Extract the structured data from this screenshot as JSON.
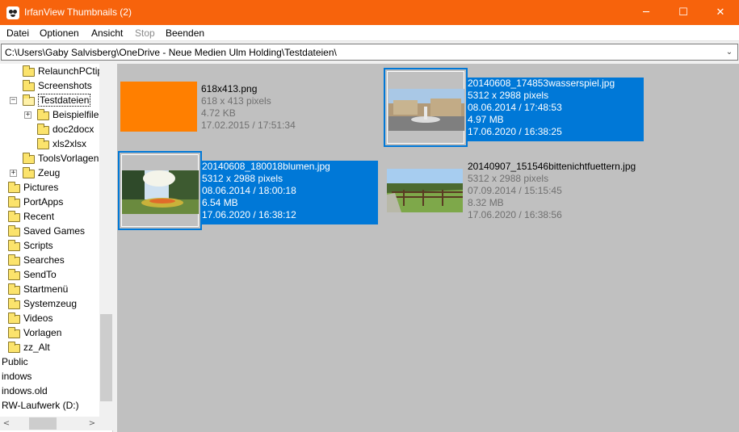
{
  "window": {
    "title": "IrfanView Thumbnails (2)",
    "minimize_glyph": "─",
    "maximize_glyph": "☐",
    "close_glyph": "✕"
  },
  "menu": {
    "items": [
      {
        "label": "Datei",
        "enabled": true
      },
      {
        "label": "Optionen",
        "enabled": true
      },
      {
        "label": "Ansicht",
        "enabled": true
      },
      {
        "label": "Stop",
        "enabled": false
      },
      {
        "label": "Beenden",
        "enabled": true
      }
    ]
  },
  "pathbar": {
    "path": "C:\\Users\\Gaby Salvisberg\\OneDrive - Neue Medien Ulm Holding\\Testdateien\\",
    "dropdown_glyph": "⌄"
  },
  "tree": {
    "items": [
      {
        "label": "RelaunchPCtip",
        "expander": "",
        "open": false
      },
      {
        "label": "Screenshots",
        "expander": "",
        "open": false
      },
      {
        "label": "Testdateien",
        "expander": "−",
        "open": true,
        "selected": true
      },
      {
        "label": "Beispielfile",
        "expander": "+",
        "open": false
      },
      {
        "label": "doc2docx",
        "expander": "",
        "open": false
      },
      {
        "label": "xls2xlsx",
        "expander": "",
        "open": false
      },
      {
        "label": "ToolsVorlagen",
        "expander": "",
        "open": false
      },
      {
        "label": "Zeug",
        "expander": "+",
        "open": false
      },
      {
        "label": "Pictures",
        "expander": "",
        "open": false
      },
      {
        "label": "PortApps",
        "expander": "",
        "open": false
      },
      {
        "label": "Recent",
        "expander": "",
        "open": false
      },
      {
        "label": "Saved Games",
        "expander": "",
        "open": false
      },
      {
        "label": "Scripts",
        "expander": "",
        "open": false
      },
      {
        "label": "Searches",
        "expander": "",
        "open": false
      },
      {
        "label": "SendTo",
        "expander": "",
        "open": false
      },
      {
        "label": "Startmenü",
        "expander": "",
        "open": false
      },
      {
        "label": "Systemzeug",
        "expander": "",
        "open": false
      },
      {
        "label": "Videos",
        "expander": "",
        "open": false
      },
      {
        "label": "Vorlagen",
        "expander": "",
        "open": false
      },
      {
        "label": "zz_Alt",
        "expander": "",
        "open": false
      },
      {
        "label": "Public",
        "expander": "",
        "open": false
      },
      {
        "label": "indows",
        "expander": "",
        "open": false
      },
      {
        "label": "indows.old",
        "expander": "",
        "open": false
      },
      {
        "label": "RW-Laufwerk (D:)",
        "expander": "",
        "open": false
      }
    ],
    "scroll_left_glyph": "<",
    "scroll_right_glyph": ">"
  },
  "thumbnails": [
    {
      "name": "618x413.png",
      "dimensions": "618 x 413 pixels",
      "size": "4.72 KB",
      "date": "17.02.2015 / 17:51:34",
      "selected": false,
      "image": "orange-solid"
    },
    {
      "name": "20140608_174853wasserspiel.jpg",
      "dimensions": "5312 x 2988 pixels",
      "size": "4.97 MB",
      "captured": "08.06.2014 / 17:48:53",
      "date": "17.06.2020 / 16:38:25",
      "selected": true,
      "image": "fountain-photo"
    },
    {
      "name": "20140608_180018blumen.jpg",
      "dimensions": "5312 x 2988 pixels",
      "size": "6.54 MB",
      "captured": "08.06.2014 / 18:00:18",
      "date": "17.06.2020 / 16:38:12",
      "selected": true,
      "image": "garden-photo"
    },
    {
      "name": "20140907_151546bittenichtfuettern.jpg",
      "dimensions": "5312 x 2988 pixels",
      "size": "8.32 MB",
      "captured": "07.09.2014 / 15:15:45",
      "date": "17.06.2020 / 16:38:56",
      "selected": false,
      "image": "fence-photo"
    }
  ],
  "colors": {
    "titlebar": "#f7630c",
    "selection": "#0078d7",
    "thumb_background": "#c0c0c0"
  }
}
